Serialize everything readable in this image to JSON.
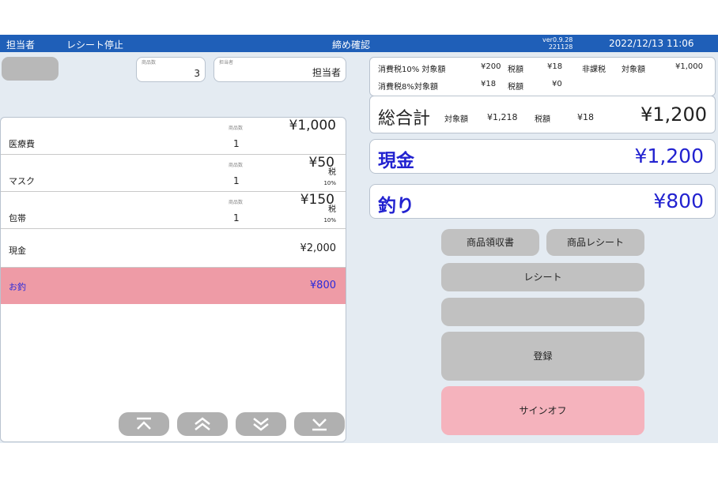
{
  "topbar": {
    "operator": "担当者",
    "receipt_stop": "レシート停止",
    "screen_title": "締め確認",
    "version_line1": "ver0.9.28",
    "version_line2": "221128",
    "datetime": "2022/12/13 11:06"
  },
  "summary": {
    "item_count_caption": "商品数",
    "item_count": "3",
    "staff_caption": "担当者",
    "staff": "担当者"
  },
  "items": [
    {
      "name": "医療費",
      "qty_caption": "商品数",
      "qty": "1",
      "price": "¥1,000",
      "tax_label": "",
      "tax_rate": ""
    },
    {
      "name": "マスク",
      "qty_caption": "商品数",
      "qty": "1",
      "price": "¥50",
      "tax_label": "税",
      "tax_rate": "10%"
    },
    {
      "name": "包帯",
      "qty_caption": "商品数",
      "qty": "1",
      "price": "¥150",
      "tax_label": "税",
      "tax_rate": "10%"
    }
  ],
  "payment_row": {
    "name": "現金",
    "amount": "¥2,000"
  },
  "change_row": {
    "name": "お釣",
    "amount": "¥800"
  },
  "tax_summary": {
    "tax10_label": "消費税10% 対象額",
    "tax10_base": "¥200",
    "tax10_tax_label": "税額",
    "tax10_tax": "¥18",
    "exempt_label": "非課税",
    "exempt_base_label": "対象額",
    "exempt_base": "¥1,000",
    "tax8_label": "消費税8%対象額",
    "tax8_base": "¥18",
    "tax8_tax_label": "税額",
    "tax8_tax": "¥0"
  },
  "grand_total": {
    "label": "総合計",
    "base_label": "対象額",
    "base": "¥1,218",
    "tax_label": "税額",
    "tax": "¥18",
    "total": "¥1,200"
  },
  "cash": {
    "label": "現金",
    "amount": "¥1,200"
  },
  "change": {
    "label": "釣り",
    "amount": "¥800"
  },
  "buttons": {
    "product_receipt": "商品領収書",
    "product_slip": "商品レシート",
    "receipt": "レシート",
    "blank": "",
    "register": "登録",
    "sign_off": "サインオフ"
  },
  "colors": {
    "topbar": "#1f5fb8",
    "accent_text": "#2222d0",
    "change_row": "#ee9ba6",
    "sign_off": "#f5b3bd"
  }
}
